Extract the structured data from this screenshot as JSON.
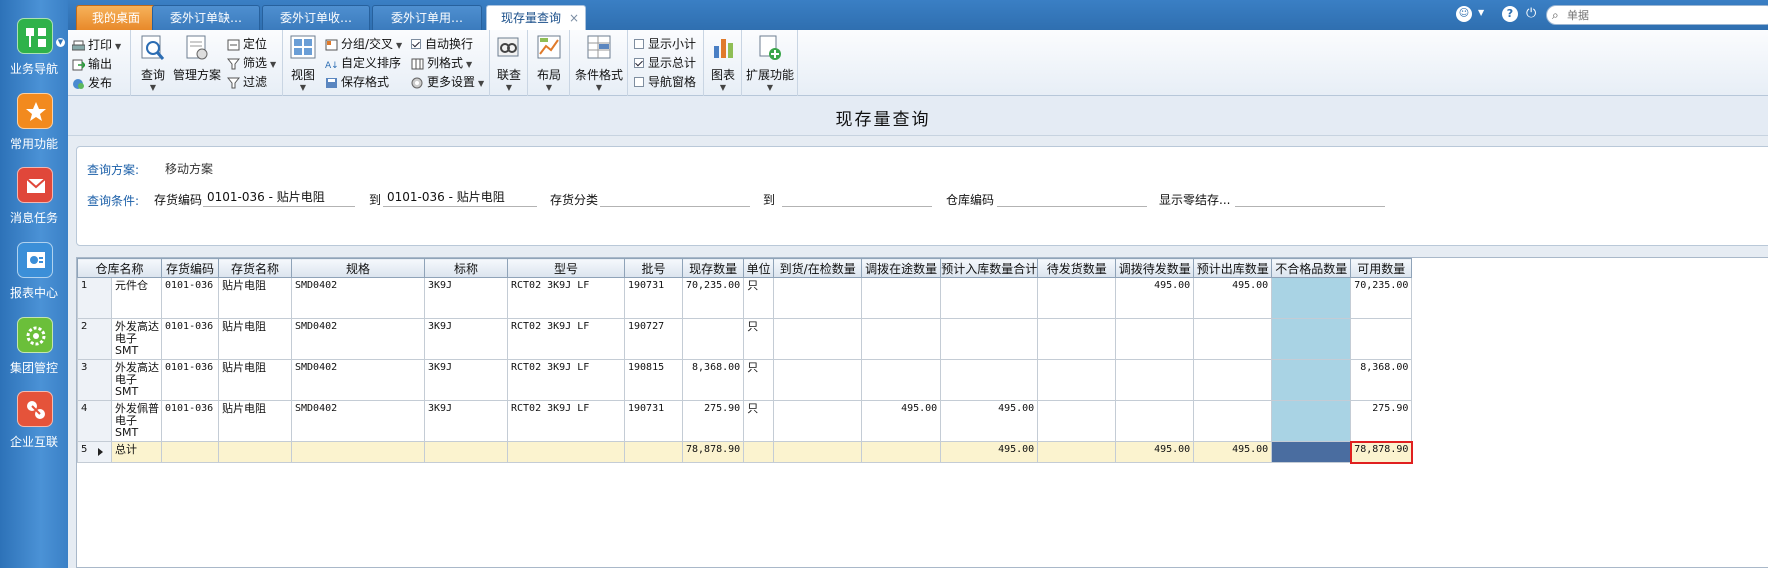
{
  "nav": {
    "items": [
      {
        "label": "业务导航",
        "icon": "business-nav-icon",
        "color": "#2fb24a"
      },
      {
        "label": "常用功能",
        "icon": "favorites-star-icon",
        "color": "#f28a1e"
      },
      {
        "label": "消息任务",
        "icon": "message-task-icon",
        "color": "#e0473a"
      },
      {
        "label": "报表中心",
        "icon": "report-center-icon",
        "color": "#3b8fd8"
      },
      {
        "label": "集团管控",
        "icon": "group-control-icon",
        "color": "#6bbf3a"
      },
      {
        "label": "企业互联",
        "icon": "enterprise-link-icon",
        "color": "#e5533a"
      }
    ]
  },
  "tabs": {
    "home": "我的桌面",
    "items": [
      "委外订单缺…",
      "委外订单收…",
      "委外订单用…"
    ],
    "active": "现存量查询",
    "close": "×"
  },
  "topright": {
    "search_placeholder": "单据"
  },
  "ribbon": {
    "print": "打印",
    "export": "输出",
    "publish": "发布",
    "query": "查询",
    "manage_scheme": "管理方案",
    "locate": "定位",
    "filter_select": "筛选",
    "filter": "过滤",
    "view": "视图",
    "group_cross": "分组/交叉",
    "custom_sort": "自定义排序",
    "save_format": "保存格式",
    "auto_wrap": "自动换行",
    "column_format": "列格式",
    "more_settings": "更多设置",
    "link_query": "联查",
    "layout": "布局",
    "cond_format": "条件格式",
    "show_subtotal": "显示小计",
    "show_total": "显示总计",
    "nav_pane": "导航窗格",
    "chart": "图表",
    "extend": "扩展功能",
    "show_subtotal_checked": false,
    "show_total_checked": true,
    "nav_pane_checked": false
  },
  "page": {
    "title": "现存量查询"
  },
  "query": {
    "scheme_label": "查询方案:",
    "scheme_value": "移动方案",
    "cond_label": "查询条件:",
    "inv_code_label": "存货编码",
    "inv_code_from": "0101-036 - 贴片电阻",
    "to_label": "到",
    "inv_code_to": "0101-036 - 贴片电阻",
    "inv_class_label": "存货分类",
    "inv_class_from": "",
    "to_label2": "到",
    "inv_class_to": "",
    "wh_code_label": "仓库编码",
    "wh_code_value": "",
    "show_zero_label": "显示零结存...",
    "show_zero_value": ""
  },
  "grid": {
    "columns": [
      "仓库名称",
      "存货编码",
      "存货名称",
      "规格",
      "标称",
      "型号",
      "批号",
      "现存数量",
      "单位",
      "到货/在检数量",
      "调拨在途数量",
      "预计入库数量合计",
      "待发货数量",
      "调拨待发数量",
      "预计出库数量",
      "不合格品数量",
      "可用数量"
    ],
    "rows": [
      {
        "no": "1",
        "cells": [
          "元件仓",
          "0101-036",
          "贴片电阻",
          "SMD0402",
          "3K9J",
          "RCT02 3K9J LF",
          "190731",
          "70,235.00",
          "只",
          "",
          "",
          "",
          "",
          "495.00",
          "495.00",
          "",
          "70,235.00"
        ]
      },
      {
        "no": "2",
        "cells": [
          "外发高达电子SMT",
          "0101-036",
          "贴片电阻",
          "SMD0402",
          "3K9J",
          "RCT02 3K9J LF",
          "190727",
          "",
          "只",
          "",
          "",
          "",
          "",
          "",
          "",
          "",
          ""
        ]
      },
      {
        "no": "3",
        "cells": [
          "外发高达电子SMT",
          "0101-036",
          "贴片电阻",
          "SMD0402",
          "3K9J",
          "RCT02 3K9J LF",
          "190815",
          "8,368.00",
          "只",
          "",
          "",
          "",
          "",
          "",
          "",
          "",
          "8,368.00"
        ]
      },
      {
        "no": "4",
        "cells": [
          "外发佩普电子SMT",
          "0101-036",
          "贴片电阻",
          "SMD0402",
          "3K9J",
          "RCT02 3K9J LF",
          "190731",
          "275.90",
          "只",
          "",
          "495.00",
          "495.00",
          "",
          "",
          "",
          "",
          "275.90"
        ]
      }
    ],
    "total": {
      "no": "5",
      "cells": [
        "总计",
        "",
        "",
        "",
        "",
        "",
        "",
        "78,878.90",
        "",
        "",
        "",
        "495.00",
        "",
        "495.00",
        "495.00",
        "",
        "78,878.90"
      ]
    }
  }
}
